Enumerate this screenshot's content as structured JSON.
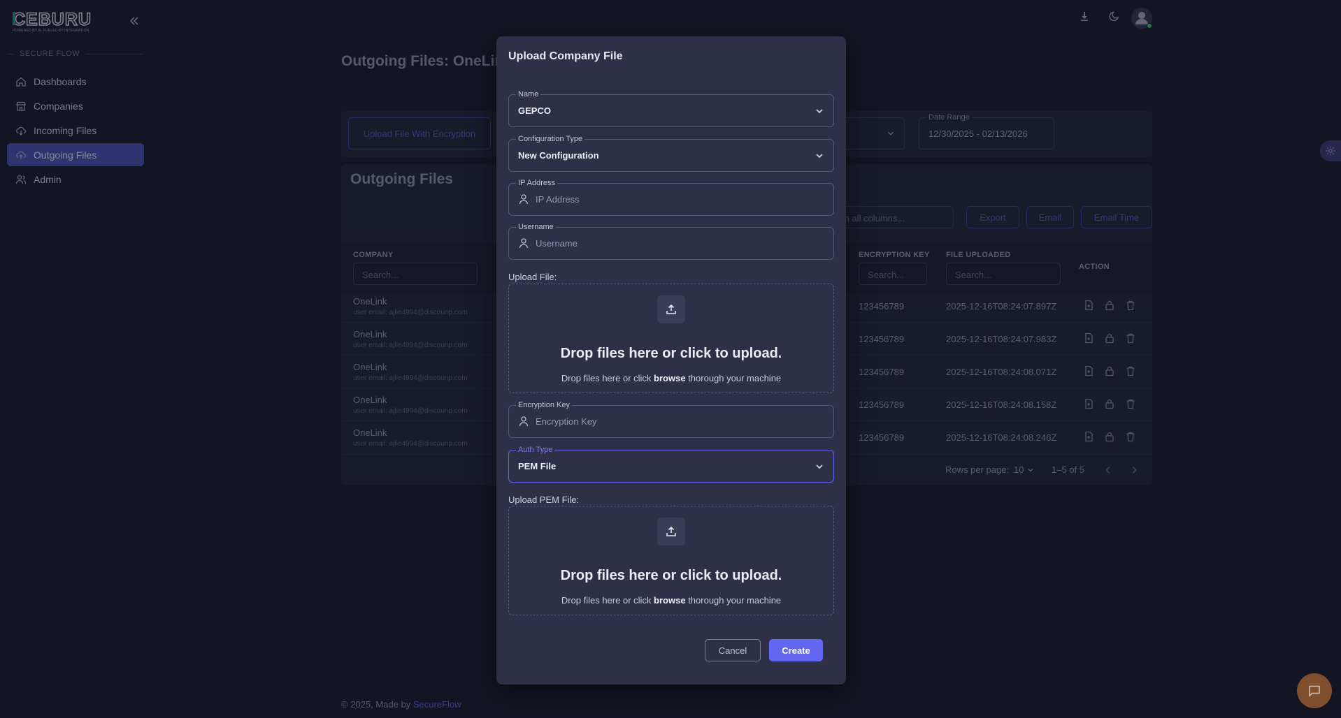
{
  "brand": {
    "name": "CEBURU",
    "tagline": "POWERED BY AI. FUELED BY INTEGRATION."
  },
  "sidebar": {
    "section": "SECURE FLOW",
    "items": [
      {
        "label": "Dashboards",
        "icon": "home-icon"
      },
      {
        "label": "Companies",
        "icon": "store-icon"
      },
      {
        "label": "Incoming Files",
        "icon": "cloud-download-icon"
      },
      {
        "label": "Outgoing Files",
        "icon": "cloud-upload-icon",
        "active": true
      },
      {
        "label": "Admin",
        "icon": "users-icon"
      }
    ]
  },
  "page": {
    "title": "Outgoing Files: OneLink",
    "upload_button": "Upload File With Encryption",
    "date_range_label": "Date Range",
    "date_range_value": "12/30/2025 - 02/13/2026",
    "card_title": "Outgoing Files",
    "search_placeholder": "ch all columns...",
    "export_button": "Export",
    "email_button": "Email",
    "email_time_button": "Email Time"
  },
  "table": {
    "columns": {
      "company": "COMPANY",
      "encryption_key": "ENCRYPTION KEY",
      "file_uploaded": "FILE UPLOADED",
      "action": "ACTION"
    },
    "filter_placeholder": "Search...",
    "rows": [
      {
        "company": "OneLink",
        "email": "user email: ajlie4994@discounp.com",
        "key": "123456789",
        "uploaded": "2025-12-16T08:24:07.897Z"
      },
      {
        "company": "OneLink",
        "email": "user email: ajlie4994@discounp.com",
        "key": "123456789",
        "uploaded": "2025-12-16T08:24:07.983Z"
      },
      {
        "company": "OneLink",
        "email": "user email: ajlie4994@discounp.com",
        "key": "123456789",
        "uploaded": "2025-12-16T08:24:08.071Z"
      },
      {
        "company": "OneLink",
        "email": "user email: ajlie4994@discounp.com",
        "key": "123456789",
        "uploaded": "2025-12-16T08:24:08.158Z"
      },
      {
        "company": "OneLink",
        "email": "user email: ajlie4994@discounp.com",
        "key": "123456789",
        "uploaded": "2025-12-16T08:24:08.246Z"
      }
    ],
    "rows_per_page_label": "Rows per page:",
    "rows_per_page_value": "10",
    "range": "1–5 of 5"
  },
  "modal": {
    "title": "Upload Company File",
    "name": {
      "label": "Name",
      "value": "GEPCO"
    },
    "config_type": {
      "label": "Configuration Type",
      "value": "New Configuration"
    },
    "ip_address": {
      "label": "IP Address",
      "placeholder": "IP Address"
    },
    "username": {
      "label": "Username",
      "placeholder": "Username"
    },
    "upload_file": {
      "label": "Upload File:",
      "title": "Drop files here or click to upload.",
      "sub_before": "Drop files here or click",
      "sub_bold": "browse",
      "sub_after": "thorough your machine"
    },
    "encryption_key": {
      "label": "Encryption Key",
      "placeholder": "Encryption Key"
    },
    "auth_type": {
      "label": "Auth Type",
      "value": "PEM File"
    },
    "upload_pem": {
      "label": "Upload PEM File:",
      "title": "Drop files here or click to upload.",
      "sub_before": "Drop files here or click",
      "sub_bold": "browse",
      "sub_after": "thorough your machine"
    },
    "cancel": "Cancel",
    "create": "Create"
  },
  "footer": {
    "text": "© 2025, Made by",
    "link": "SecureFlow"
  },
  "colors": {
    "accent": "#6366f1",
    "background": "#1b1d2d",
    "modal": "#2d3047",
    "active_nav": "#4f4fb3"
  }
}
